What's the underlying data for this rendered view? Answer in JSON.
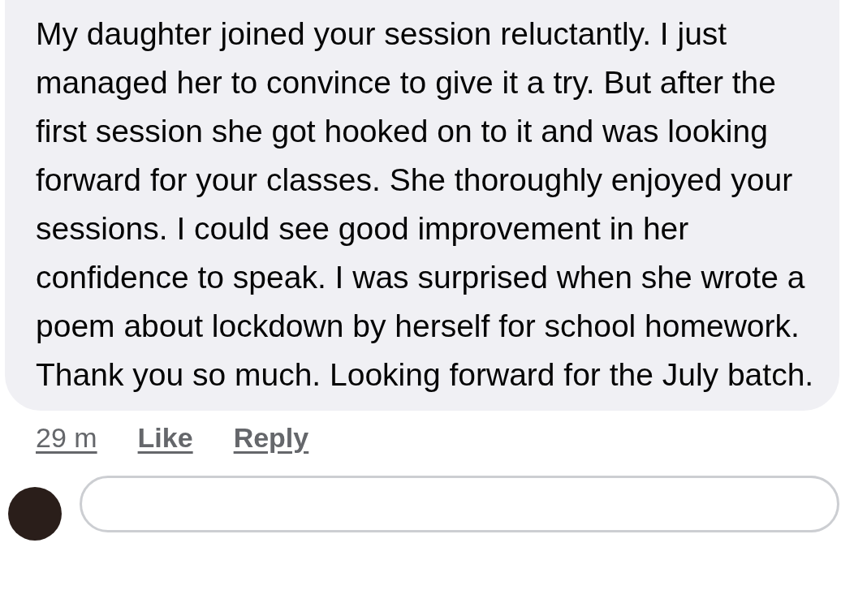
{
  "comment": {
    "text": "My daughter joined your session reluctantly. I just managed her to convince to give it a try. But after the first session she got hooked on to it and was looking forward for your classes. She thoroughly enjoyed your sessions. I could see good improvement in her confidence to speak. I was surprised when she wrote a poem about lockdown by herself for school homework. Thank you so much. Looking forward for the July batch.",
    "actions": [
      {
        "kind": "time",
        "label": "29 m"
      },
      {
        "kind": "like",
        "label": "Like"
      },
      {
        "kind": "reply",
        "label": "Reply"
      }
    ]
  }
}
